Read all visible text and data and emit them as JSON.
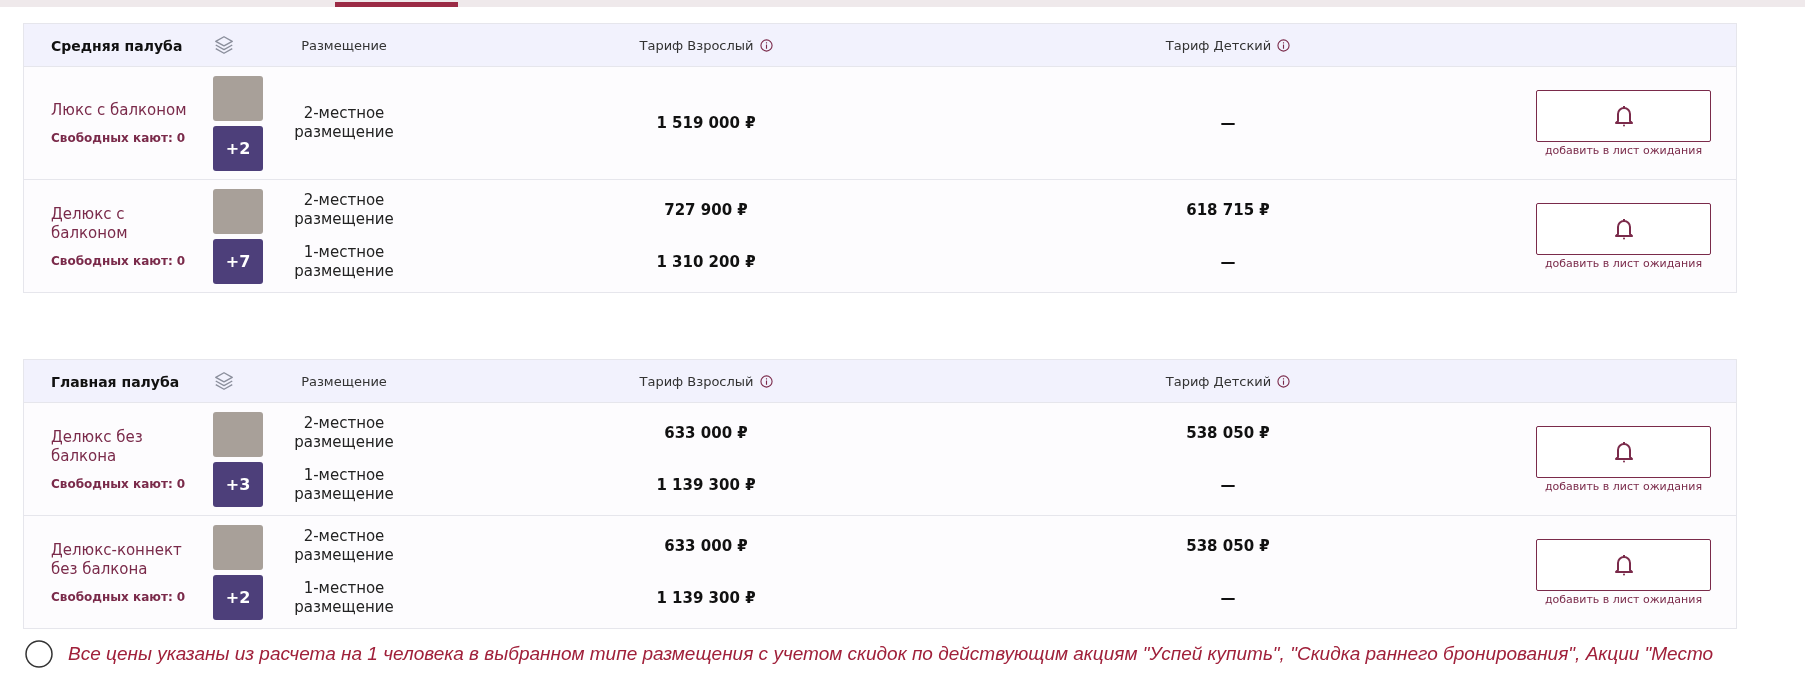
{
  "decks": [
    {
      "title": "Средняя палуба",
      "headers": {
        "placement": "Размещение",
        "adult": "Тариф Взрослый",
        "child": "Тариф Детский"
      },
      "cabins": [
        {
          "name": "Люкс с балконом",
          "free": "Свободных кают: 0",
          "more_photos": "+2",
          "waitlist": "добавить в лист ожидания",
          "options": [
            {
              "placement": "2-местное размещение",
              "adult": "1 519 000 ₽",
              "child": "—"
            }
          ]
        },
        {
          "name": "Делюкс с балконом",
          "free": "Свободных кают: 0",
          "more_photos": "+7",
          "waitlist": "добавить в лист ожидания",
          "options": [
            {
              "placement": "2-местное размещение",
              "adult": "727 900 ₽",
              "child": "618 715 ₽"
            },
            {
              "placement": "1-местное размещение",
              "adult": "1 310 200 ₽",
              "child": "—"
            }
          ]
        }
      ]
    },
    {
      "title": "Главная палуба",
      "headers": {
        "placement": "Размещение",
        "adult": "Тариф Взрослый",
        "child": "Тариф Детский"
      },
      "cabins": [
        {
          "name": "Делюкс без балкона",
          "free": "Свободных кают: 0",
          "more_photos": "+3",
          "waitlist": "добавить в лист ожидания",
          "options": [
            {
              "placement": "2-местное размещение",
              "adult": "633 000 ₽",
              "child": "538 050 ₽"
            },
            {
              "placement": "1-местное размещение",
              "adult": "1 139 300 ₽",
              "child": "—"
            }
          ]
        },
        {
          "name": "Делюкс-коннект без балкона",
          "free": "Свободных кают: 0",
          "more_photos": "+2",
          "waitlist": "добавить в лист ожидания",
          "options": [
            {
              "placement": "2-местное размещение",
              "adult": "633 000 ₽",
              "child": "538 050 ₽"
            },
            {
              "placement": "1-местное размещение",
              "adult": "1 139 300 ₽",
              "child": "—"
            }
          ]
        }
      ]
    }
  ],
  "note": "Все цены указаны из расчета на 1 человека в выбранном типе размещения с учетом скидок по действующим акциям \"Успей купить\", \"Скидка раннего бронирования\", Акции \"Место"
}
